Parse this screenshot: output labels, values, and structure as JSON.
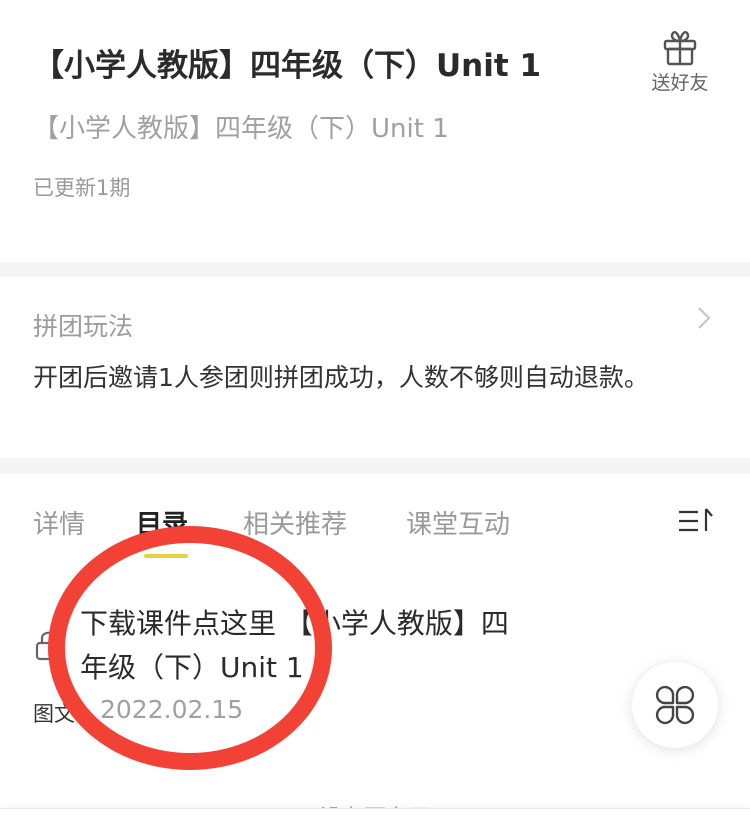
{
  "header": {
    "title": "【小学人教版】四年级（下）Unit 1",
    "subtitle": "【小学人教版】四年级（下）Unit 1",
    "updated": "已更新1期",
    "gift_icon": "gift-icon",
    "gift_label": "送好友"
  },
  "group_buy": {
    "label": "拼团玩法",
    "description": "开团后邀请1人参团则拼团成功，人数不够则自动退款。",
    "chevron_icon": "chevron-right-icon"
  },
  "tabs": {
    "items": [
      {
        "label": "详情",
        "active": false
      },
      {
        "label": "目录",
        "active": true
      },
      {
        "label": "相关推荐",
        "active": false
      },
      {
        "label": "课堂互动",
        "active": false
      }
    ],
    "sort_icon": "sort-icon",
    "indicator_color": "#e6d23e"
  },
  "lessons": [
    {
      "title": "下载课件点这里 【小学人教版】四年级（下）Unit 1",
      "locked": true,
      "lock_icon": "lock-icon",
      "type": "图文",
      "date": "2022.02.15"
    }
  ],
  "floating_button": {
    "icon": "clover-menu-icon"
  },
  "footer": {
    "no_more": "没有更多了"
  },
  "annotation": {
    "shape": "red-ellipse",
    "color": "#f24236",
    "target": "lesson title"
  }
}
